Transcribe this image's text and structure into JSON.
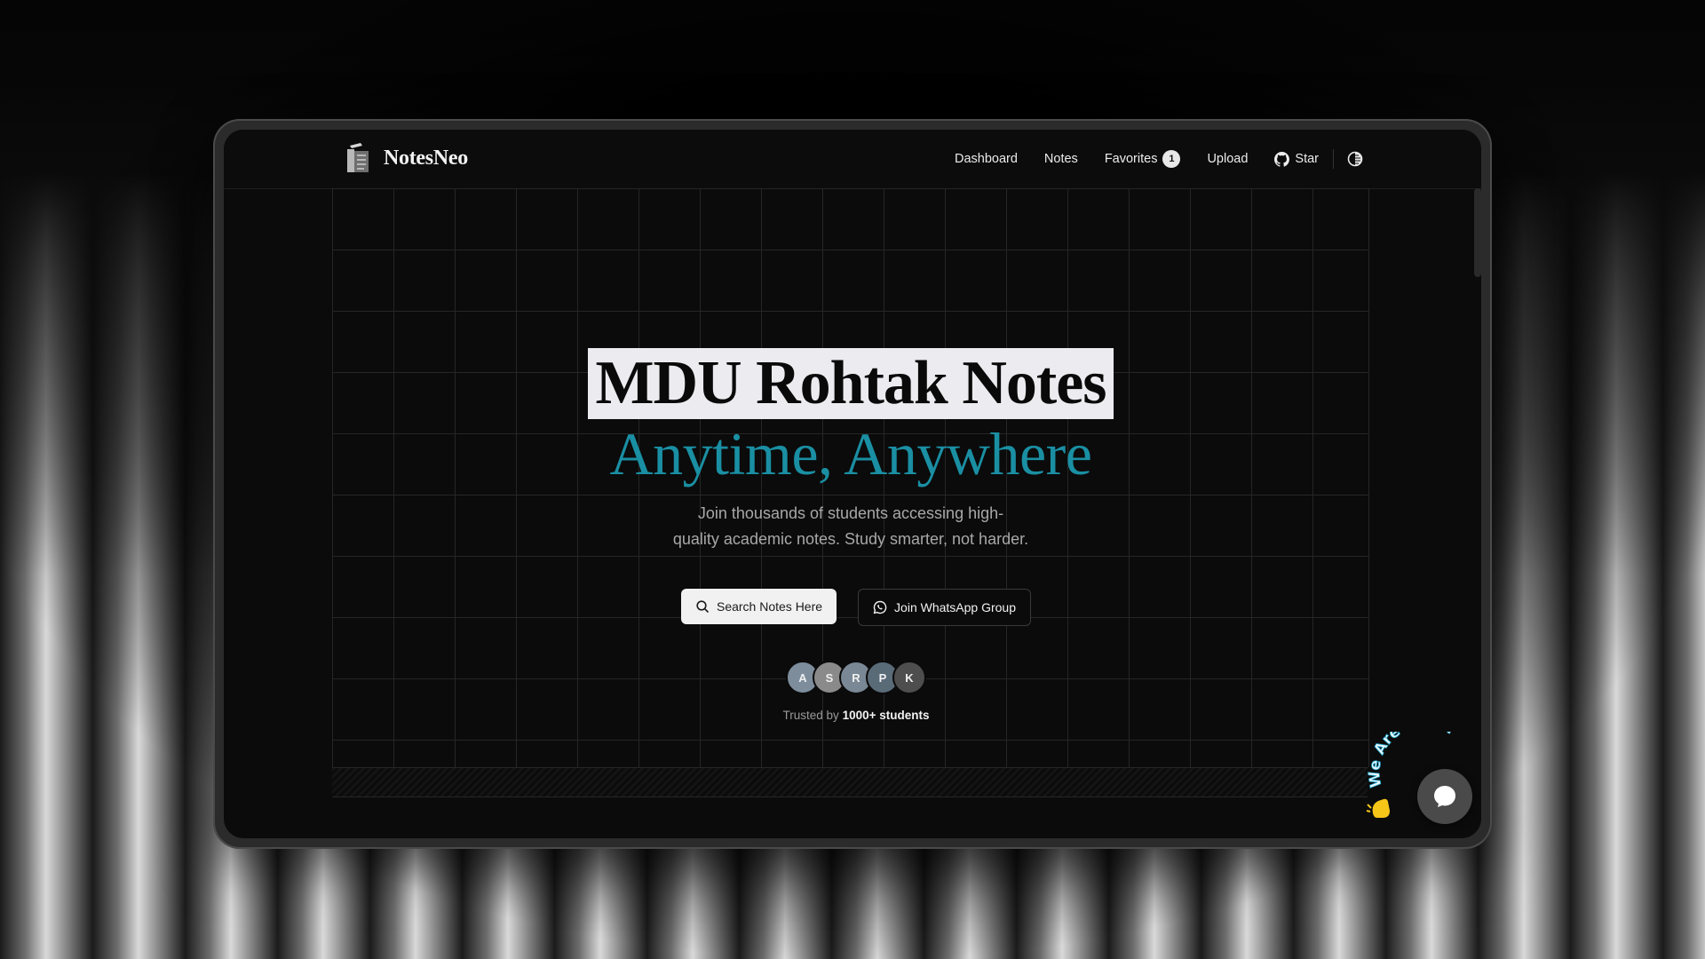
{
  "brand": {
    "name": "NotesNeo"
  },
  "nav": {
    "dashboard": "Dashboard",
    "notes": "Notes",
    "favorites": "Favorites",
    "favorites_count": "1",
    "upload": "Upload",
    "star": "Star"
  },
  "hero": {
    "title_line1": "MDU Rohtak Notes",
    "title_line2": "Anytime, Anywhere",
    "subtitle_line1": "Join thousands of students accessing high-",
    "subtitle_line2": "quality academic notes. Study smarter, not harder.",
    "search_button": "Search Notes Here",
    "whatsapp_button": "Join WhatsApp Group",
    "avatars": [
      "A",
      "S",
      "R",
      "P",
      "K"
    ],
    "trusted_prefix": "Trusted by",
    "trusted_count": "1000+ students"
  },
  "chat": {
    "label": "We Are Here!"
  },
  "colors": {
    "accent": "#1a8fa3",
    "title_highlight": "#ececf0",
    "avatar_colors": [
      "#7d8d9c",
      "#8a8a8a",
      "#7a8794",
      "#5a6b78",
      "#4e4e4e"
    ]
  },
  "icons": {
    "logo": "notebook-icon",
    "github": "github-icon",
    "theme": "theme-toggle-icon",
    "search": "search-icon",
    "whatsapp": "whatsapp-icon",
    "chat": "chat-bubble-icon",
    "wave": "waving-hand-icon"
  }
}
